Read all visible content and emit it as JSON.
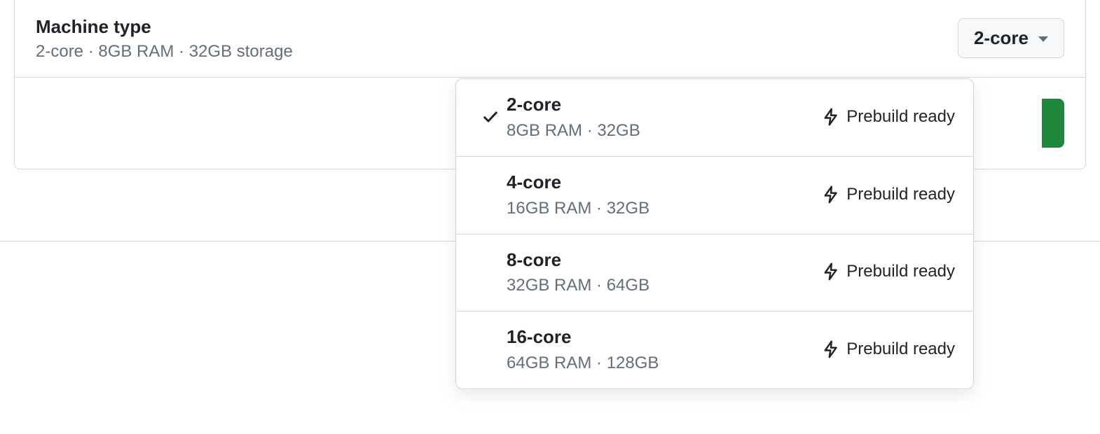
{
  "header": {
    "title": "Machine type",
    "subtitle": "2-core · 8GB RAM · 32GB storage",
    "selected_label": "2-core"
  },
  "prebuild_label": "Prebuild ready",
  "options": [
    {
      "title": "2-core",
      "sub": "8GB RAM · 32GB",
      "selected": true
    },
    {
      "title": "4-core",
      "sub": "16GB RAM · 32GB",
      "selected": false
    },
    {
      "title": "8-core",
      "sub": "32GB RAM · 64GB",
      "selected": false
    },
    {
      "title": "16-core",
      "sub": "64GB RAM · 128GB",
      "selected": false
    }
  ]
}
